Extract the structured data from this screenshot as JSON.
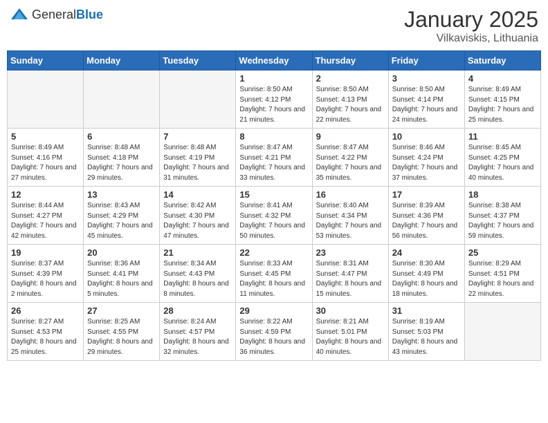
{
  "header": {
    "logo_general": "General",
    "logo_blue": "Blue",
    "month": "January 2025",
    "location": "Vilkaviskis, Lithuania"
  },
  "weekdays": [
    "Sunday",
    "Monday",
    "Tuesday",
    "Wednesday",
    "Thursday",
    "Friday",
    "Saturday"
  ],
  "weeks": [
    [
      {
        "day": "",
        "sunrise": "",
        "sunset": "",
        "daylight": "",
        "empty": true
      },
      {
        "day": "",
        "sunrise": "",
        "sunset": "",
        "daylight": "",
        "empty": true
      },
      {
        "day": "",
        "sunrise": "",
        "sunset": "",
        "daylight": "",
        "empty": true
      },
      {
        "day": "1",
        "sunrise": "Sunrise: 8:50 AM",
        "sunset": "Sunset: 4:12 PM",
        "daylight": "Daylight: 7 hours and 21 minutes.",
        "empty": false
      },
      {
        "day": "2",
        "sunrise": "Sunrise: 8:50 AM",
        "sunset": "Sunset: 4:13 PM",
        "daylight": "Daylight: 7 hours and 22 minutes.",
        "empty": false
      },
      {
        "day": "3",
        "sunrise": "Sunrise: 8:50 AM",
        "sunset": "Sunset: 4:14 PM",
        "daylight": "Daylight: 7 hours and 24 minutes.",
        "empty": false
      },
      {
        "day": "4",
        "sunrise": "Sunrise: 8:49 AM",
        "sunset": "Sunset: 4:15 PM",
        "daylight": "Daylight: 7 hours and 25 minutes.",
        "empty": false
      }
    ],
    [
      {
        "day": "5",
        "sunrise": "Sunrise: 8:49 AM",
        "sunset": "Sunset: 4:16 PM",
        "daylight": "Daylight: 7 hours and 27 minutes.",
        "empty": false
      },
      {
        "day": "6",
        "sunrise": "Sunrise: 8:48 AM",
        "sunset": "Sunset: 4:18 PM",
        "daylight": "Daylight: 7 hours and 29 minutes.",
        "empty": false
      },
      {
        "day": "7",
        "sunrise": "Sunrise: 8:48 AM",
        "sunset": "Sunset: 4:19 PM",
        "daylight": "Daylight: 7 hours and 31 minutes.",
        "empty": false
      },
      {
        "day": "8",
        "sunrise": "Sunrise: 8:47 AM",
        "sunset": "Sunset: 4:21 PM",
        "daylight": "Daylight: 7 hours and 33 minutes.",
        "empty": false
      },
      {
        "day": "9",
        "sunrise": "Sunrise: 8:47 AM",
        "sunset": "Sunset: 4:22 PM",
        "daylight": "Daylight: 7 hours and 35 minutes.",
        "empty": false
      },
      {
        "day": "10",
        "sunrise": "Sunrise: 8:46 AM",
        "sunset": "Sunset: 4:24 PM",
        "daylight": "Daylight: 7 hours and 37 minutes.",
        "empty": false
      },
      {
        "day": "11",
        "sunrise": "Sunrise: 8:45 AM",
        "sunset": "Sunset: 4:25 PM",
        "daylight": "Daylight: 7 hours and 40 minutes.",
        "empty": false
      }
    ],
    [
      {
        "day": "12",
        "sunrise": "Sunrise: 8:44 AM",
        "sunset": "Sunset: 4:27 PM",
        "daylight": "Daylight: 7 hours and 42 minutes.",
        "empty": false
      },
      {
        "day": "13",
        "sunrise": "Sunrise: 8:43 AM",
        "sunset": "Sunset: 4:29 PM",
        "daylight": "Daylight: 7 hours and 45 minutes.",
        "empty": false
      },
      {
        "day": "14",
        "sunrise": "Sunrise: 8:42 AM",
        "sunset": "Sunset: 4:30 PM",
        "daylight": "Daylight: 7 hours and 47 minutes.",
        "empty": false
      },
      {
        "day": "15",
        "sunrise": "Sunrise: 8:41 AM",
        "sunset": "Sunset: 4:32 PM",
        "daylight": "Daylight: 7 hours and 50 minutes.",
        "empty": false
      },
      {
        "day": "16",
        "sunrise": "Sunrise: 8:40 AM",
        "sunset": "Sunset: 4:34 PM",
        "daylight": "Daylight: 7 hours and 53 minutes.",
        "empty": false
      },
      {
        "day": "17",
        "sunrise": "Sunrise: 8:39 AM",
        "sunset": "Sunset: 4:36 PM",
        "daylight": "Daylight: 7 hours and 56 minutes.",
        "empty": false
      },
      {
        "day": "18",
        "sunrise": "Sunrise: 8:38 AM",
        "sunset": "Sunset: 4:37 PM",
        "daylight": "Daylight: 7 hours and 59 minutes.",
        "empty": false
      }
    ],
    [
      {
        "day": "19",
        "sunrise": "Sunrise: 8:37 AM",
        "sunset": "Sunset: 4:39 PM",
        "daylight": "Daylight: 8 hours and 2 minutes.",
        "empty": false
      },
      {
        "day": "20",
        "sunrise": "Sunrise: 8:36 AM",
        "sunset": "Sunset: 4:41 PM",
        "daylight": "Daylight: 8 hours and 5 minutes.",
        "empty": false
      },
      {
        "day": "21",
        "sunrise": "Sunrise: 8:34 AM",
        "sunset": "Sunset: 4:43 PM",
        "daylight": "Daylight: 8 hours and 8 minutes.",
        "empty": false
      },
      {
        "day": "22",
        "sunrise": "Sunrise: 8:33 AM",
        "sunset": "Sunset: 4:45 PM",
        "daylight": "Daylight: 8 hours and 11 minutes.",
        "empty": false
      },
      {
        "day": "23",
        "sunrise": "Sunrise: 8:31 AM",
        "sunset": "Sunset: 4:47 PM",
        "daylight": "Daylight: 8 hours and 15 minutes.",
        "empty": false
      },
      {
        "day": "24",
        "sunrise": "Sunrise: 8:30 AM",
        "sunset": "Sunset: 4:49 PM",
        "daylight": "Daylight: 8 hours and 18 minutes.",
        "empty": false
      },
      {
        "day": "25",
        "sunrise": "Sunrise: 8:29 AM",
        "sunset": "Sunset: 4:51 PM",
        "daylight": "Daylight: 8 hours and 22 minutes.",
        "empty": false
      }
    ],
    [
      {
        "day": "26",
        "sunrise": "Sunrise: 8:27 AM",
        "sunset": "Sunset: 4:53 PM",
        "daylight": "Daylight: 8 hours and 25 minutes.",
        "empty": false
      },
      {
        "day": "27",
        "sunrise": "Sunrise: 8:25 AM",
        "sunset": "Sunset: 4:55 PM",
        "daylight": "Daylight: 8 hours and 29 minutes.",
        "empty": false
      },
      {
        "day": "28",
        "sunrise": "Sunrise: 8:24 AM",
        "sunset": "Sunset: 4:57 PM",
        "daylight": "Daylight: 8 hours and 32 minutes.",
        "empty": false
      },
      {
        "day": "29",
        "sunrise": "Sunrise: 8:22 AM",
        "sunset": "Sunset: 4:59 PM",
        "daylight": "Daylight: 8 hours and 36 minutes.",
        "empty": false
      },
      {
        "day": "30",
        "sunrise": "Sunrise: 8:21 AM",
        "sunset": "Sunset: 5:01 PM",
        "daylight": "Daylight: 8 hours and 40 minutes.",
        "empty": false
      },
      {
        "day": "31",
        "sunrise": "Sunrise: 8:19 AM",
        "sunset": "Sunset: 5:03 PM",
        "daylight": "Daylight: 8 hours and 43 minutes.",
        "empty": false
      },
      {
        "day": "",
        "sunrise": "",
        "sunset": "",
        "daylight": "",
        "empty": true
      }
    ]
  ]
}
